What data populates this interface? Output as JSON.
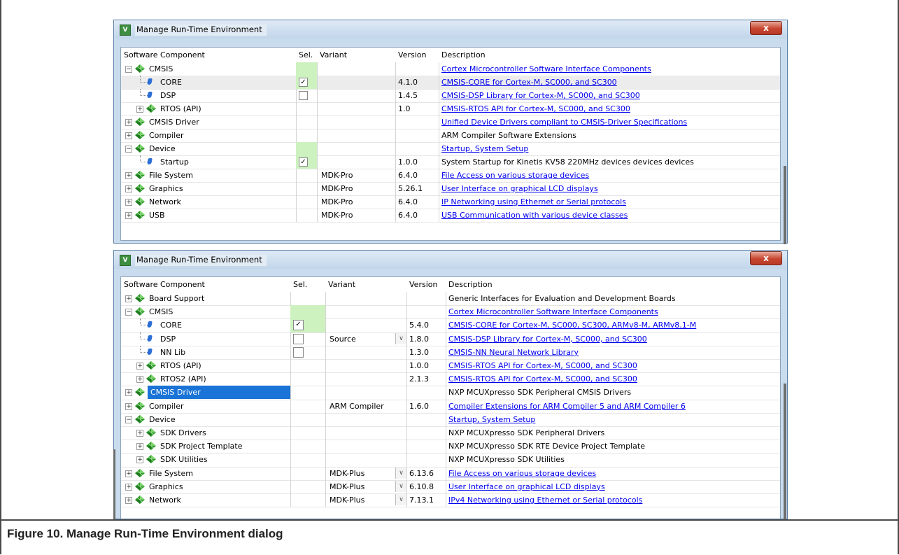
{
  "windows": [
    {
      "title": "Manage Run-Time Environment",
      "close_label": "x",
      "headers": {
        "component": "Software Component",
        "sel": "Sel.",
        "variant": "Variant",
        "version": "Version",
        "description": "Description"
      },
      "rows": [
        {
          "label": "CMSIS",
          "level": 0,
          "expander": "−",
          "icon": "green-diamond-icon",
          "sel": "",
          "selbg": true,
          "variant": "",
          "version": "",
          "description": "Cortex Microcontroller Software Interface Components",
          "link": true
        },
        {
          "label": "CORE",
          "level": 1,
          "expander": "",
          "icon": "blue-component-icon",
          "sel": "✓",
          "selbg": true,
          "variant": "",
          "version": "4.1.0",
          "description": "CMSIS-CORE for Cortex-M, SC000, and SC300",
          "link": true,
          "rowbg": "#ececec"
        },
        {
          "label": "DSP",
          "level": 1,
          "expander": "",
          "icon": "blue-component-icon",
          "sel": "",
          "checkbox": true,
          "variant": "",
          "version": "1.4.5",
          "description": "CMSIS-DSP Library for Cortex-M, SC000, and SC300",
          "link": true
        },
        {
          "label": "RTOS (API)",
          "level": 1,
          "expander": "+",
          "icon": "green-diamond-icon",
          "sel": "",
          "variant": "",
          "version": "1.0",
          "description": "CMSIS-RTOS API for Cortex-M, SC000, and SC300",
          "link": true
        },
        {
          "label": "CMSIS Driver",
          "level": 0,
          "expander": "+",
          "icon": "green-diamond-icon",
          "sel": "",
          "variant": "",
          "version": "",
          "description": "Unified Device Drivers compliant to CMSIS-Driver Specifications",
          "link": true
        },
        {
          "label": "Compiler",
          "level": 0,
          "expander": "+",
          "icon": "green-diamond-icon",
          "sel": "",
          "variant": "",
          "version": "",
          "description": "ARM Compiler Software Extensions",
          "link": false
        },
        {
          "label": "Device",
          "level": 0,
          "expander": "−",
          "icon": "green-diamond-icon",
          "sel": "",
          "selbg": true,
          "variant": "",
          "version": "",
          "description": "Startup, System Setup",
          "link": true
        },
        {
          "label": "Startup",
          "level": 1,
          "expander": "",
          "icon": "blue-component-icon",
          "sel": "✓",
          "selbg": true,
          "variant": "",
          "version": "1.0.0",
          "description": "System Startup for Kinetis KV58 220MHz devices devices devices",
          "link": false
        },
        {
          "label": "File System",
          "level": 0,
          "expander": "+",
          "icon": "green-diamond-icon",
          "sel": "",
          "variant": "MDK-Pro",
          "version": "6.4.0",
          "description": "File Access on various storage devices",
          "link": true
        },
        {
          "label": "Graphics",
          "level": 0,
          "expander": "+",
          "icon": "green-diamond-icon",
          "sel": "",
          "variant": "MDK-Pro",
          "version": "5.26.1",
          "description": "User Interface on graphical LCD displays",
          "link": true
        },
        {
          "label": "Network",
          "level": 0,
          "expander": "+",
          "icon": "green-diamond-icon",
          "sel": "",
          "variant": "MDK-Pro",
          "version": "6.4.0",
          "description": "IP Networking using Ethernet or Serial protocols",
          "link": true
        },
        {
          "label": "USB",
          "level": 0,
          "expander": "+",
          "icon": "green-diamond-icon",
          "sel": "",
          "variant": "MDK-Pro",
          "version": "6.4.0",
          "description": "USB Communication with various device classes",
          "link": true
        }
      ]
    },
    {
      "title": "Manage Run-Time Environment",
      "close_label": "x",
      "headers": {
        "component": "Software Component",
        "sel": "Sel.",
        "variant": "Variant",
        "version": "Version",
        "description": "Description"
      },
      "rows": [
        {
          "label": "Board Support",
          "level": 0,
          "expander": "+",
          "icon": "green-diamond-icon",
          "sel": "",
          "variant": "",
          "version": "",
          "description": "Generic Interfaces for Evaluation and Development Boards",
          "link": false
        },
        {
          "label": "CMSIS",
          "level": 0,
          "expander": "−",
          "icon": "green-diamond-icon",
          "sel": "",
          "selbg": true,
          "variant": "",
          "version": "",
          "description": "Cortex Microcontroller Software Interface Components",
          "link": true
        },
        {
          "label": "CORE",
          "level": 1,
          "expander": "",
          "icon": "blue-component-icon",
          "sel": "✓",
          "selbg": true,
          "checkbox": true,
          "variant": "",
          "version": "5.4.0",
          "description": "CMSIS-CORE for Cortex-M, SC000, SC300, ARMv8-M, ARMv8.1-M",
          "link": true
        },
        {
          "label": "DSP",
          "level": 1,
          "expander": "",
          "icon": "blue-component-icon",
          "sel": "",
          "checkbox": true,
          "variant": "Source",
          "dropdown": true,
          "version": "1.8.0",
          "description": "CMSIS-DSP Library for Cortex-M, SC000, and SC300",
          "link": true
        },
        {
          "label": "NN Lib",
          "level": 1,
          "expander": "",
          "icon": "blue-component-icon",
          "sel": "",
          "checkbox": true,
          "variant": "",
          "version": "1.3.0",
          "description": "CMSIS-NN Neural Network Library",
          "link": true
        },
        {
          "label": "RTOS (API)",
          "level": 1,
          "expander": "+",
          "icon": "green-diamond-icon",
          "sel": "",
          "variant": "",
          "version": "1.0.0",
          "description": "CMSIS-RTOS API for Cortex-M, SC000, and SC300",
          "link": true
        },
        {
          "label": "RTOS2 (API)",
          "level": 1,
          "expander": "+",
          "icon": "green-diamond-icon",
          "sel": "",
          "variant": "",
          "version": "2.1.3",
          "description": "CMSIS-RTOS API for Cortex-M, SC000, and SC300",
          "link": true
        },
        {
          "label": "CMSIS Driver",
          "level": 0,
          "expander": "+",
          "icon": "green-diamond-icon",
          "sel": "",
          "variant": "",
          "version": "",
          "description": "NXP MCUXpresso SDK Peripheral CMSIS Drivers",
          "link": false,
          "highlight": true
        },
        {
          "label": "Compiler",
          "level": 0,
          "expander": "+",
          "icon": "green-diamond-icon",
          "sel": "",
          "variant": "ARM Compiler",
          "version": "1.6.0",
          "description": "Compiler Extensions for ARM Compiler 5 and ARM Compiler 6",
          "link": true
        },
        {
          "label": "Device",
          "level": 0,
          "expander": "−",
          "icon": "green-diamond-icon",
          "sel": "",
          "variant": "",
          "version": "",
          "description": "Startup, System Setup",
          "link": true
        },
        {
          "label": "SDK Drivers",
          "level": 1,
          "expander": "+",
          "icon": "green-diamond-icon",
          "sel": "",
          "variant": "",
          "version": "",
          "description": "NXP MCUXpresso SDK Peripheral Drivers",
          "link": false
        },
        {
          "label": "SDK Project Template",
          "level": 1,
          "expander": "+",
          "icon": "green-diamond-icon",
          "sel": "",
          "variant": "",
          "version": "",
          "description": "NXP MCUXpresso SDK RTE Device Project Template",
          "link": false
        },
        {
          "label": "SDK Utilities",
          "level": 1,
          "expander": "+",
          "icon": "green-diamond-icon",
          "sel": "",
          "variant": "",
          "version": "",
          "description": "NXP MCUXpresso SDK Utilities",
          "link": false
        },
        {
          "label": "File System",
          "level": 0,
          "expander": "+",
          "icon": "green-diamond-icon",
          "sel": "",
          "variant": "MDK-Plus",
          "dropdown": true,
          "version": "6.13.6",
          "description": "File Access on various storage devices",
          "link": true
        },
        {
          "label": "Graphics",
          "level": 0,
          "expander": "+",
          "icon": "green-diamond-icon",
          "sel": "",
          "variant": "MDK-Plus",
          "dropdown": true,
          "version": "6.10.8",
          "description": "User Interface on graphical LCD displays",
          "link": true
        },
        {
          "label": "Network",
          "level": 0,
          "expander": "+",
          "icon": "green-diamond-icon",
          "sel": "",
          "variant": "MDK-Plus",
          "dropdown": true,
          "version": "7.13.1",
          "description": "IPv4 Networking using Ethernet or Serial protocols",
          "link": true
        }
      ]
    }
  ],
  "caption": "Figure 10. Manage Run-Time Environment dialog",
  "colors": {
    "link": "#0000ee",
    "selection": "#1a73d6",
    "sel_green": "#cdf2c0",
    "diamond_green": "#2e9b2e",
    "component_blue": "#2b6fd6"
  }
}
